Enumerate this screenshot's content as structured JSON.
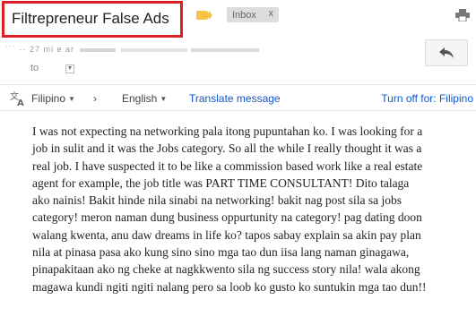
{
  "message": {
    "subject": "Filtrepreneur False Ads",
    "label_chip": "Inbox",
    "label_chip_close": "x",
    "sender_fragment": "˙˙˙  ··  27   mi   e   ar",
    "recipient": "to",
    "body_lines": [
      "I was not expecting na networking pala itong pupuntahan ko. I was looking for a",
      "job in sulit and it was the Jobs category. So all the while I really thought it was a",
      "real job. I have suspected it to be like a commission based work like a real estate",
      "agent for example, the job title was PART TIME CONSULTANT! Dito talaga",
      "ako nainis! Bakit hinde nila sinabi na networking! bakit nag post sila sa jobs",
      "category! meron naman dung business oppurtunity na category! pag dating doon",
      "walang kwenta, anu daw dreams in life ko? tapos sabay explain sa akin pay plan",
      "nila at pinasa pasa ako kung sino sino mga tao dun iisa lang naman ginagawa,",
      "pinapakitaan ako ng cheke at nagkkwento sila ng success story nila! wala akong",
      "magawa kundi ngiti ngiti nalang pero sa loob ko gusto ko suntukin mga tao dun!!"
    ]
  },
  "translate_bar": {
    "source_language": "Filipino",
    "arrow": "›",
    "target_language": "English",
    "translate_link": "Translate message",
    "turn_off_link": "Turn off for: Filipino"
  },
  "icons": {
    "label": "label-tag-icon",
    "print": "print-icon",
    "reply": "reply-arrow-icon",
    "translate": "translate-icon",
    "dropdown": "chevron-down-icon"
  },
  "colors": {
    "highlight_border": "#dd1f26",
    "label_tag": "#f6c342",
    "link": "#1155cc"
  }
}
